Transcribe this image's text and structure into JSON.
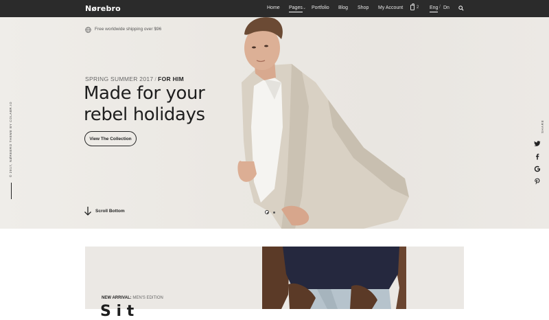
{
  "nav": {
    "logo": "Nørebro",
    "items": [
      "Home",
      "Pages",
      "Portfolio",
      "Blog",
      "Shop",
      "My Account"
    ],
    "cart_count": "2",
    "lang_active": "Eng",
    "lang_other": "Dn",
    "lang_separator": "/"
  },
  "hero": {
    "shipping": "Free worldwide shipping over $96",
    "season": "SPRING SUMMER 2017",
    "season_sep": "/",
    "season_target": "FOR HIM",
    "headline_line1": "Made for your",
    "headline_line2": "rebel holidays",
    "cta": "View The Collection",
    "scroll": "Scroll Bottom",
    "slide_count": 2,
    "active_slide": 1
  },
  "side": {
    "copyright": "© 2017, NØREBRO THEME BY COLABR.IO",
    "share_label": "SHARE",
    "share_icons": [
      "twitter-icon",
      "facebook-icon",
      "google-icon",
      "pinterest-icon"
    ]
  },
  "section2": {
    "arrival_label": "NEW ARRIVAL:",
    "arrival_value": "MEN'S EDITION",
    "peek_title": "S  i  t"
  },
  "colors": {
    "topbar": "#2b2b2b",
    "hero_bg": "#ebe8e3",
    "text_dark": "#1e1e1e"
  }
}
